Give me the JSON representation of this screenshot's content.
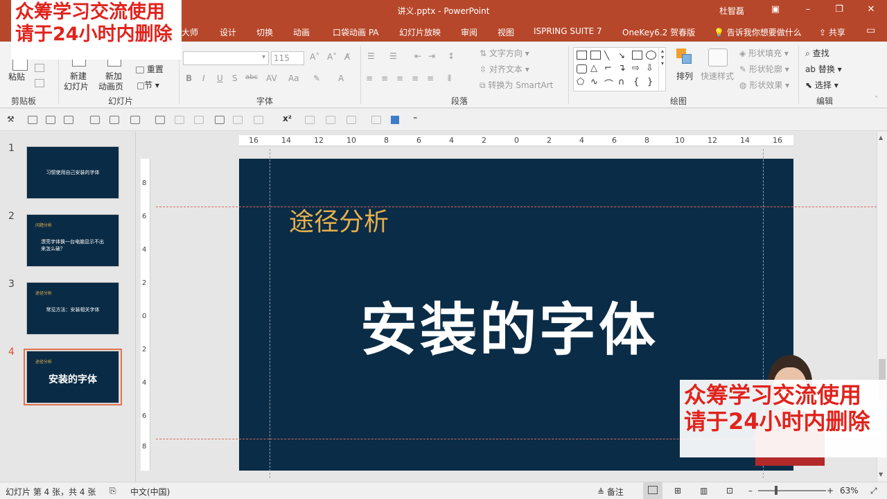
{
  "window": {
    "title": "讲义.pptx - PowerPoint",
    "user": "杜智磊",
    "minimize": "–",
    "restore": "❐",
    "close": "✕",
    "ribbon_toggle": "▣"
  },
  "tabs": [
    "大师",
    "设计",
    "切换",
    "动画",
    "口袋动画 PA",
    "幻灯片放映",
    "审阅",
    "视图",
    "ISPRING SUITE 7",
    "OneKey6.2 贺春版"
  ],
  "tell_me": "告诉我你想要做什么",
  "share": "共享",
  "ribbon": {
    "clipboard": {
      "paste": "粘贴",
      "label": "剪贴板"
    },
    "slides": {
      "new_slide_1": "新建",
      "new_slide_2": "幻灯片",
      "new_anim_1": "新加",
      "new_anim_2": "动画页",
      "reset": "重置",
      "section": "节",
      "label": "幻灯片"
    },
    "font": {
      "size": "115",
      "label": "字体",
      "bold": "B",
      "italic": "I",
      "underline": "U",
      "shadow": "S",
      "strike": "abc"
    },
    "paragraph": {
      "text_direction": "文字方向",
      "align_text": "对齐文本",
      "smartart": "转换为 SmartArt",
      "label": "段落"
    },
    "drawing": {
      "arrange": "排列",
      "quick_styles": "快速样式",
      "fill": "形状填充",
      "outline": "形状轮廓",
      "effects": "形状效果",
      "label": "绘图"
    },
    "editing": {
      "find": "查找",
      "replace": "替换",
      "select": "选择",
      "label": "编辑"
    }
  },
  "thumbnails": [
    {
      "num": "1",
      "small": "",
      "text": "习惯使用自己安装的字体"
    },
    {
      "num": "2",
      "small": "问题分析",
      "text": "漂亮字体换一台电脑显示不出来怎么破？"
    },
    {
      "num": "3",
      "small": "途径分析",
      "text": "常见方法：安装相关字体"
    },
    {
      "num": "4",
      "small": "途径分析",
      "text": "安装的字体"
    }
  ],
  "ruler": {
    "h": [
      "16",
      "14",
      "12",
      "10",
      "8",
      "6",
      "4",
      "2",
      "0",
      "2",
      "4",
      "6",
      "8",
      "10",
      "12",
      "14",
      "16"
    ],
    "v": [
      "8",
      "6",
      "4",
      "2",
      "0",
      "2",
      "4",
      "6",
      "8"
    ]
  },
  "slide": {
    "subtitle": "途径分析",
    "title": "安装的字体"
  },
  "status": {
    "slide_info": "幻灯片 第 4 张，共 4 张",
    "language": "中文(中国)",
    "notes": "备注",
    "zoom": "63%",
    "zoom_minus": "–",
    "zoom_plus": "+"
  },
  "watermark": {
    "line1": "众筹学习交流使用",
    "line2": "请于24小时内删除"
  },
  "colors": {
    "accent": "#b7472a",
    "slide_bg": "#0b2c46",
    "subtitle": "#e6b04c",
    "watermark": "#e0231c"
  }
}
